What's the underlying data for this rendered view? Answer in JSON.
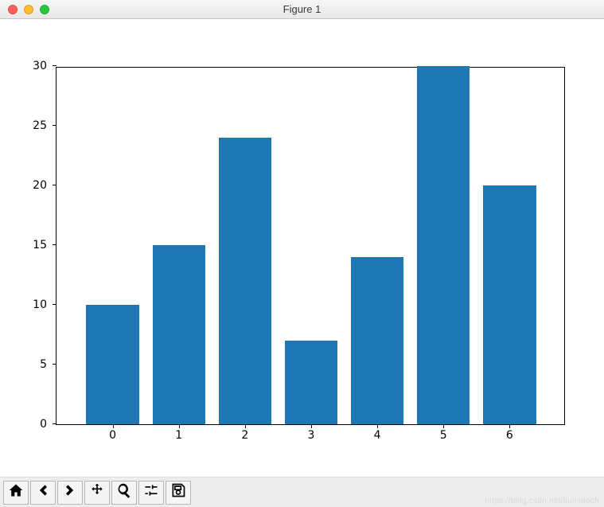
{
  "window": {
    "title": "Figure 1"
  },
  "chart_data": {
    "type": "bar",
    "categories": [
      0,
      1,
      2,
      3,
      4,
      5,
      6
    ],
    "values": [
      10,
      15,
      24,
      7,
      14,
      30,
      20
    ],
    "title": "",
    "xlabel": "",
    "ylabel": "",
    "ylim": [
      0,
      30
    ],
    "yticks": [
      0,
      5,
      10,
      15,
      20,
      25,
      30
    ],
    "xticks": [
      0,
      1,
      2,
      3,
      4,
      5,
      6
    ],
    "bar_color": "#1f77b4"
  },
  "toolbar": {
    "home": "Home",
    "back": "Back",
    "forward": "Forward",
    "pan": "Pan",
    "zoom": "Zoom",
    "configure": "Configure subplots",
    "save": "Save"
  },
  "watermark": "https://blog.csdn.net/liumiaoch"
}
